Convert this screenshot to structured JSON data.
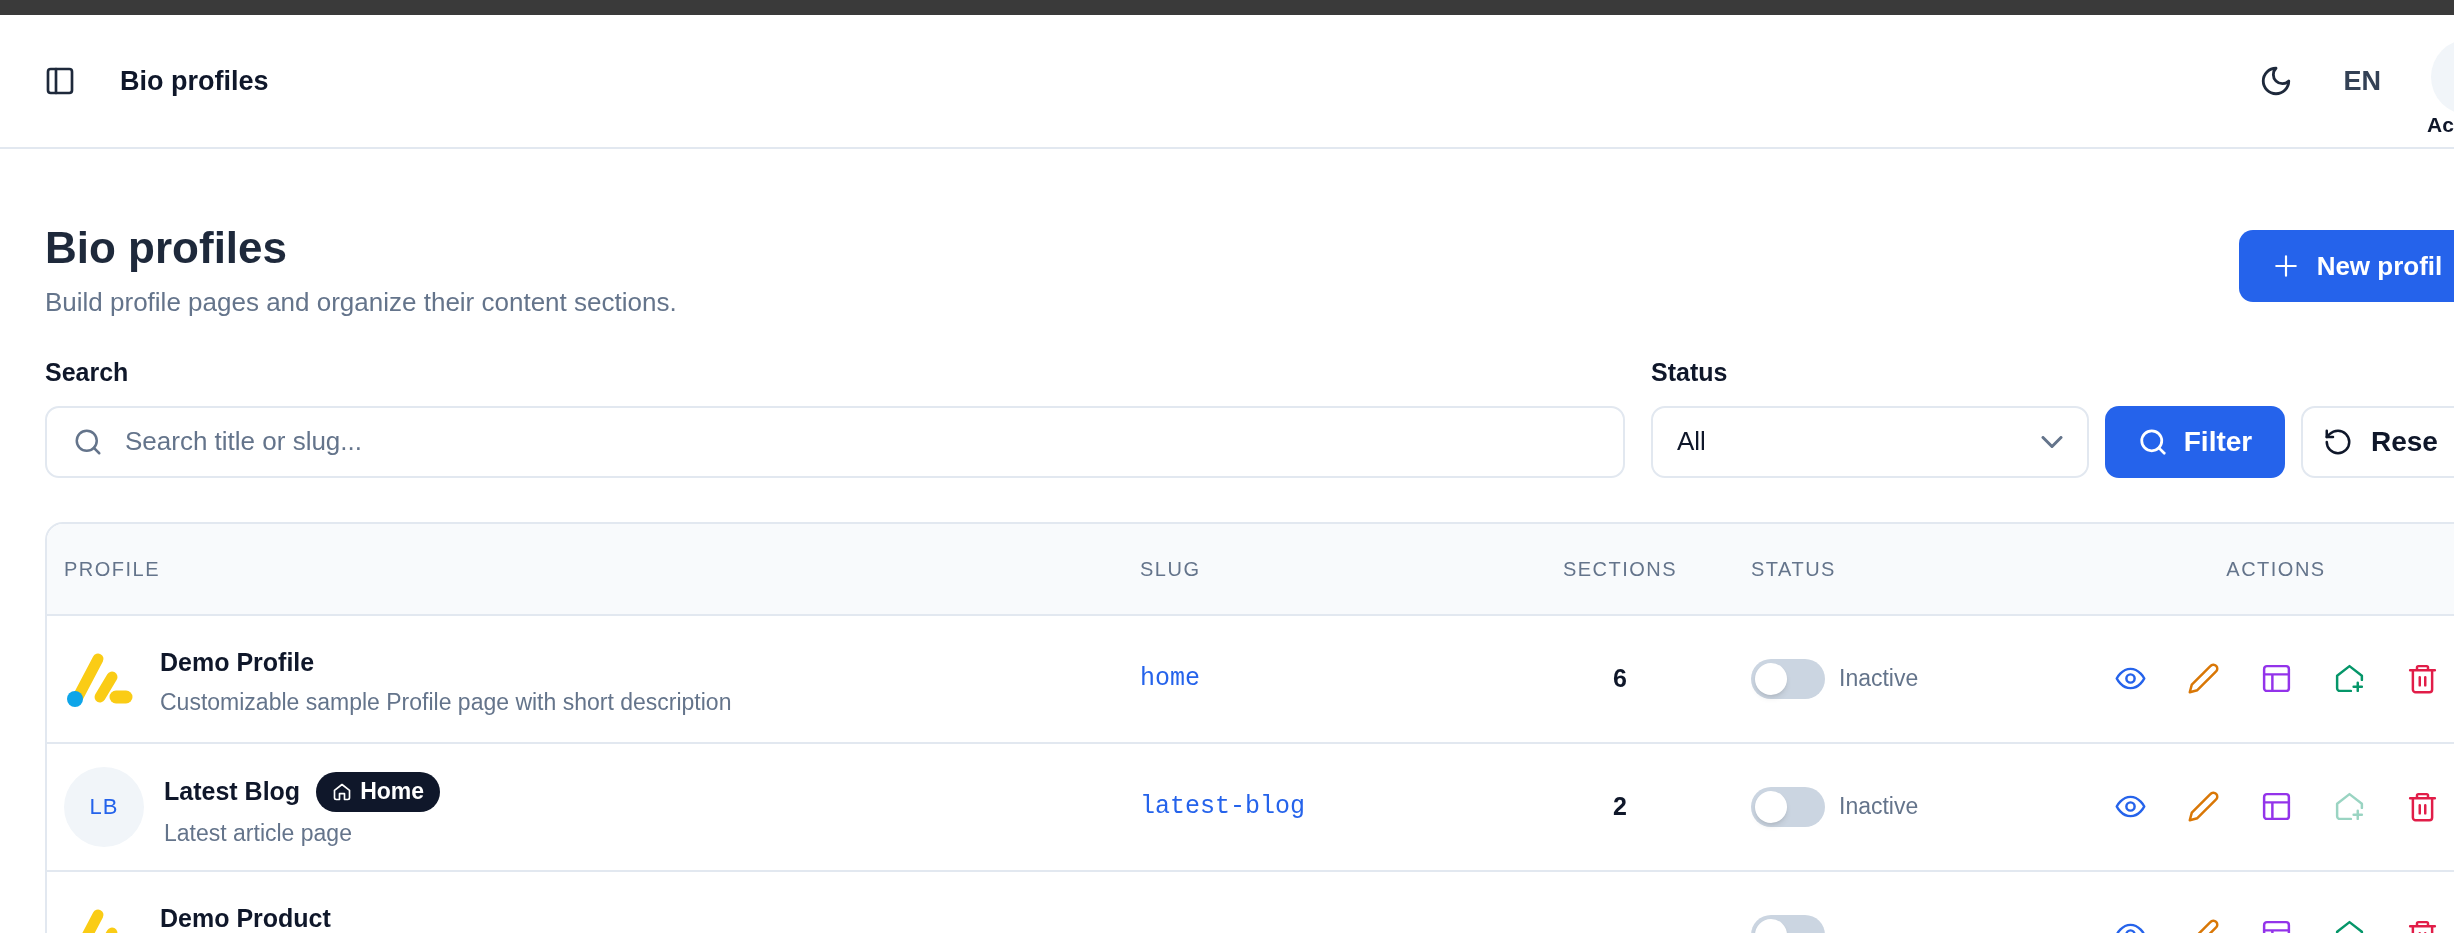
{
  "topbar": {
    "title": "Bio profiles",
    "language": "EN",
    "account_label": "Ac"
  },
  "page": {
    "title": "Bio profiles",
    "subtitle": "Build profile pages and organize their content sections.",
    "new_button": "New profil"
  },
  "filters": {
    "search_label": "Search",
    "search_placeholder": "Search title or slug...",
    "status_label": "Status",
    "status_value": "All",
    "filter_button": "Filter",
    "reset_button": "Rese"
  },
  "table": {
    "columns": [
      "PROFILE",
      "SLUG",
      "SECTIONS",
      "STATUS",
      "ACTIONS"
    ],
    "rows": [
      {
        "avatar": {
          "kind": "logo"
        },
        "name": "Demo Profile",
        "badge": null,
        "description": "Customizable sample Profile page with short description",
        "slug": "home",
        "sections": "6",
        "status_on": false,
        "status_label": "Inactive",
        "actions": [
          {
            "kind": "view",
            "disabled": false
          },
          {
            "kind": "edit",
            "disabled": false
          },
          {
            "kind": "layout",
            "disabled": false
          },
          {
            "kind": "set_home",
            "disabled": false
          },
          {
            "kind": "delete",
            "disabled": false
          }
        ]
      },
      {
        "avatar": {
          "kind": "initials",
          "text": "LB"
        },
        "name": "Latest Blog",
        "badge": "Home",
        "description": "Latest article page",
        "slug": "latest-blog",
        "sections": "2",
        "status_on": false,
        "status_label": "Inactive",
        "actions": [
          {
            "kind": "view",
            "disabled": false
          },
          {
            "kind": "edit",
            "disabled": false
          },
          {
            "kind": "layout",
            "disabled": false
          },
          {
            "kind": "set_home",
            "disabled": true
          },
          {
            "kind": "delete",
            "disabled": false
          }
        ]
      },
      {
        "avatar": {
          "kind": "logo"
        },
        "name": "Demo Product",
        "badge": null,
        "description": null,
        "slug": null,
        "sections": null,
        "status_on": false,
        "status_label": null,
        "actions": [
          {
            "kind": "view",
            "disabled": false
          },
          {
            "kind": "edit",
            "disabled": false
          },
          {
            "kind": "layout",
            "disabled": false
          },
          {
            "kind": "set_home",
            "disabled": false
          },
          {
            "kind": "delete",
            "disabled": false
          }
        ]
      }
    ]
  }
}
